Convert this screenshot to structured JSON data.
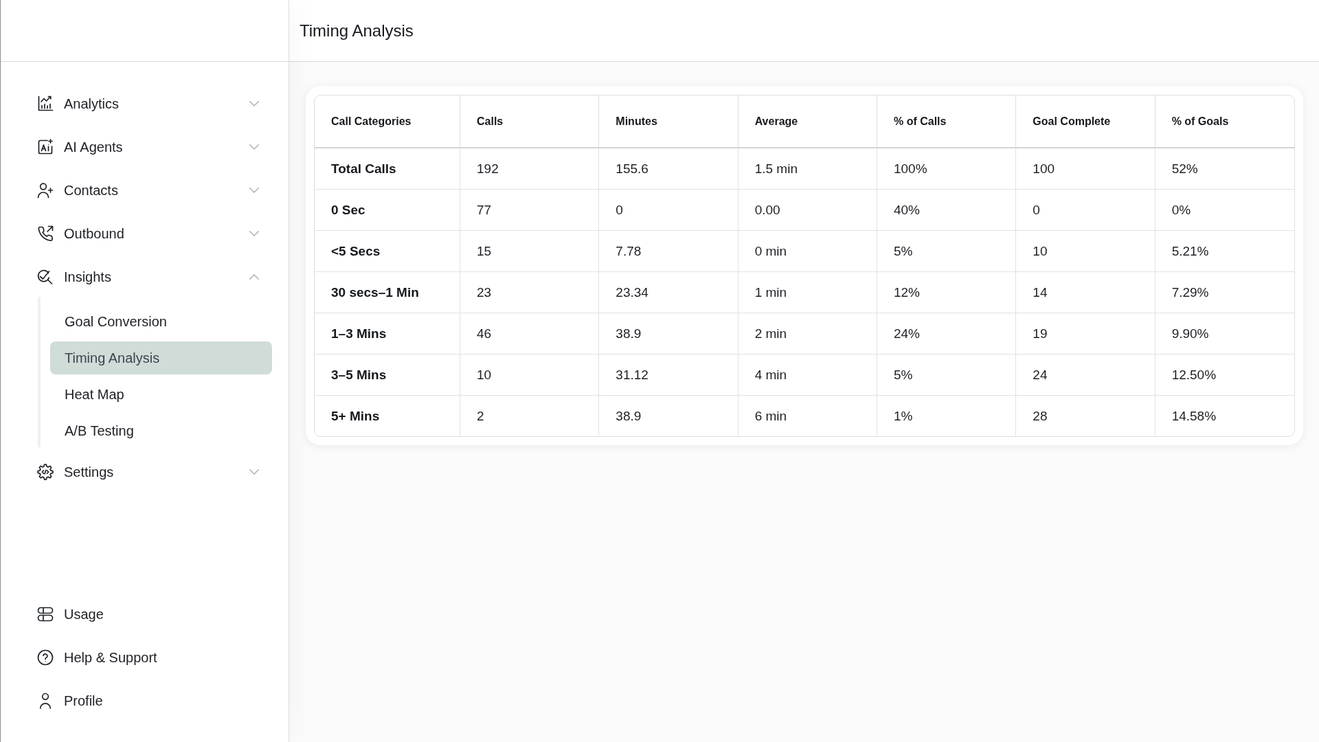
{
  "sidebar": {
    "items": [
      {
        "label": "Analytics",
        "expanded": false
      },
      {
        "label": "AI Agents",
        "expanded": false
      },
      {
        "label": "Contacts",
        "expanded": false
      },
      {
        "label": "Outbound",
        "expanded": false
      },
      {
        "label": "Insights",
        "expanded": true,
        "children": [
          {
            "label": "Goal Conversion",
            "selected": false
          },
          {
            "label": "Timing Analysis",
            "selected": true
          },
          {
            "label": "Heat Map",
            "selected": false
          },
          {
            "label": "A/B Testing",
            "selected": false
          }
        ]
      },
      {
        "label": "Settings",
        "expanded": false
      }
    ],
    "footer_items": [
      {
        "label": "Usage"
      },
      {
        "label": "Help & Support"
      },
      {
        "label": "Profile"
      }
    ]
  },
  "header": {
    "title": "Timing Analysis"
  },
  "table": {
    "columns": [
      "Call Categories",
      "Calls",
      "Minutes",
      "Average",
      "% of Calls",
      "Goal Complete",
      "% of Goals"
    ],
    "rows": [
      {
        "cells": [
          "Total Calls",
          "192",
          "155.6",
          "1.5 min",
          "100%",
          "100",
          "52%"
        ]
      },
      {
        "cells": [
          "0 Sec",
          "77",
          "0",
          "0.00",
          "40%",
          "0",
          "0%"
        ]
      },
      {
        "cells": [
          "<5 Secs",
          "15",
          "7.78",
          "0 min",
          "5%",
          "10",
          "5.21%"
        ]
      },
      {
        "cells": [
          "30 secs–1 Min",
          "23",
          "23.34",
          "1 min",
          "12%",
          "14",
          "7.29%"
        ]
      },
      {
        "cells": [
          "1–3 Mins",
          "46",
          "38.9",
          "2 min",
          "24%",
          "19",
          "9.90%"
        ]
      },
      {
        "cells": [
          "3–5 Mins",
          "10",
          "31.12",
          "4 min",
          "5%",
          "24",
          "12.50%"
        ]
      },
      {
        "cells": [
          "5+ Mins",
          "2",
          "38.9",
          "6 min",
          "1%",
          "28",
          "14.58%"
        ]
      }
    ]
  }
}
